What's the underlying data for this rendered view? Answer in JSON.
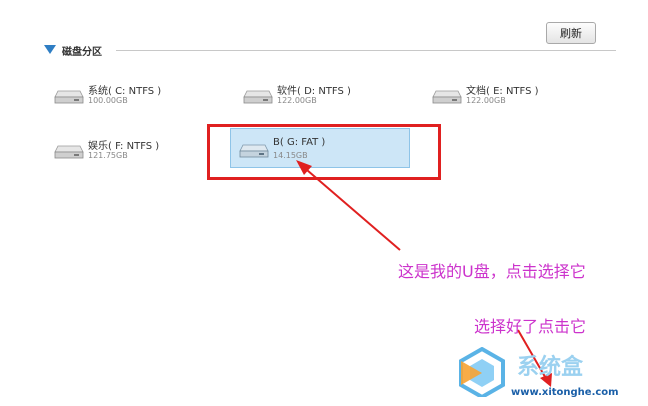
{
  "toolbar": {
    "refresh_label": "刷新"
  },
  "section": {
    "title": "磁盘分区"
  },
  "drives": [
    {
      "label": "系统( C: NTFS )",
      "size": "100.00GB",
      "selected": false
    },
    {
      "label": "软件( D: NTFS )",
      "size": "122.00GB",
      "selected": false
    },
    {
      "label": "文档( E: NTFS )",
      "size": "122.00GB",
      "selected": false
    },
    {
      "label": "娱乐( F: NTFS )",
      "size": "121.75GB",
      "selected": false
    },
    {
      "label": "B( G: FAT )",
      "size": "14.15GB",
      "selected": true
    }
  ],
  "annotations": {
    "usb_note": "这是我的U盘，点击选择它",
    "click_note": "选择好了点击它"
  },
  "watermark": {
    "brand": "系统盒",
    "url": "www.xitonghe.com"
  },
  "colors": {
    "accent": "#2e7ec4",
    "annotation": "#cc33cc",
    "highlight": "#e02020",
    "selected_bg": "#cde6f7"
  }
}
